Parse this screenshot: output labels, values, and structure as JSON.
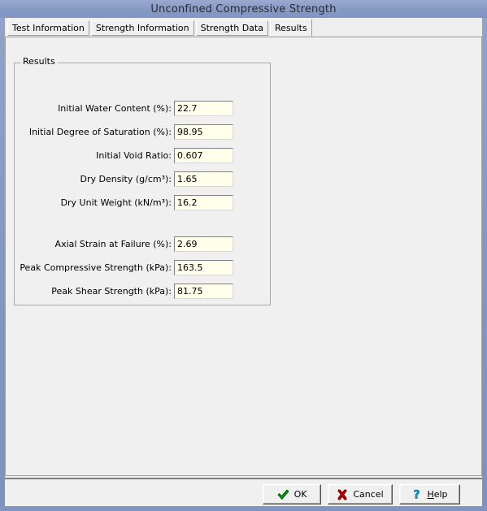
{
  "window": {
    "title": "Unconfined Compressive Strength",
    "title_bar_color": "#8698c4"
  },
  "tabs": [
    {
      "label": "Test Information",
      "active": false
    },
    {
      "label": "Strength Information",
      "active": false
    },
    {
      "label": "Strength Data",
      "active": false
    },
    {
      "label": "Results",
      "active": true
    }
  ],
  "group": {
    "legend": "Results",
    "rows": [
      {
        "label": "Initial Water Content (%):",
        "value": "22.7"
      },
      {
        "label": "Initial Degree of Saturation (%):",
        "value": "98.95"
      },
      {
        "label": "Initial Void Ratio:",
        "value": "0.607"
      },
      {
        "label": "Dry Density (g/cm³):",
        "value": "1.65"
      },
      {
        "label": "Dry Unit Weight (kN/m³):",
        "value": "16.2"
      },
      {
        "label": "Axial Strain at Failure (%):",
        "value": "2.69"
      },
      {
        "label": "Peak Compressive Strength (kPa):",
        "value": "163.5"
      },
      {
        "label": "Peak Shear Strength (kPa):",
        "value": "81.75"
      }
    ],
    "field_background": "#ffffeb"
  },
  "buttons": {
    "ok": {
      "label": "OK",
      "icon": "green-check-icon"
    },
    "cancel": {
      "label": "Cancel",
      "icon": "red-cross-icon"
    },
    "help": {
      "label_before": "H",
      "label_after": "elp",
      "icon": "blue-question-mark-icon"
    }
  }
}
